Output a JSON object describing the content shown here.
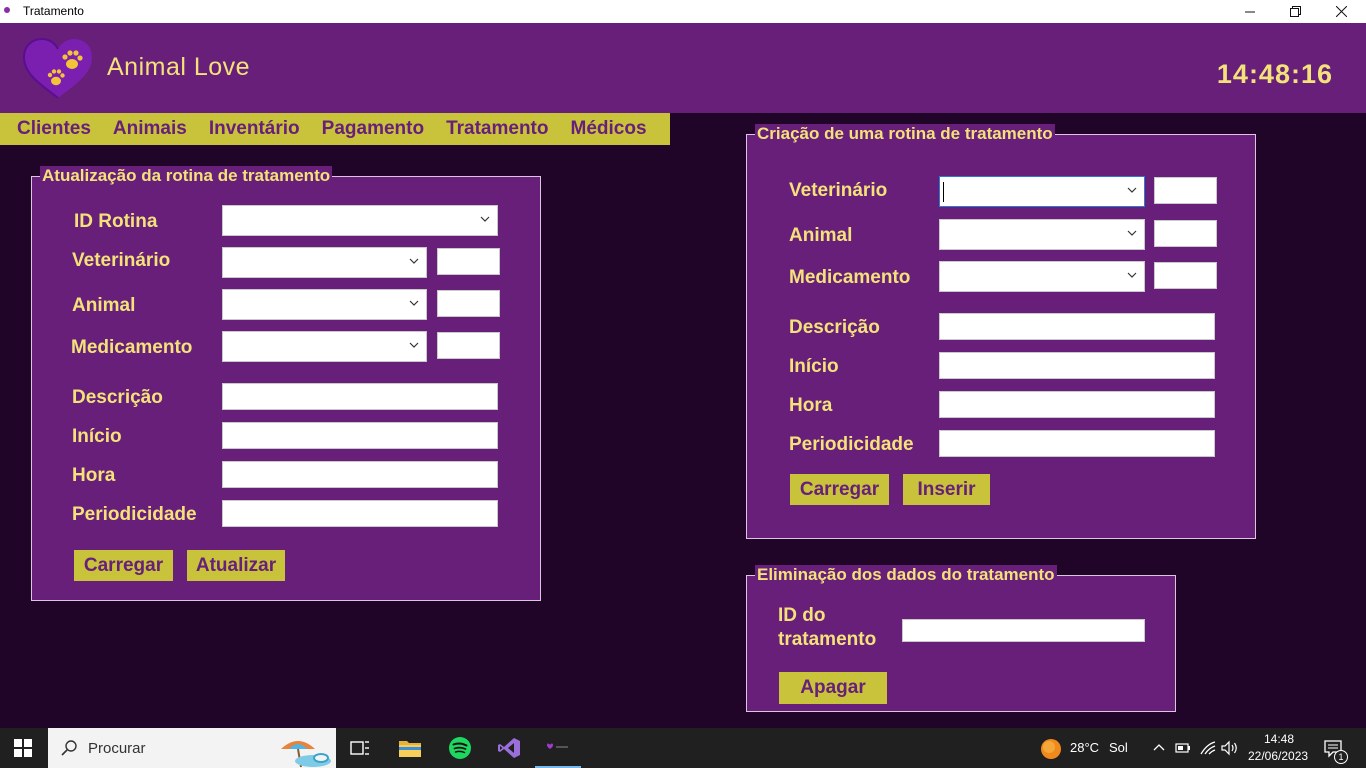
{
  "window": {
    "title": "Tratamento",
    "minimize": "—",
    "restore": "❐",
    "close": "✕"
  },
  "header": {
    "brand": "Animal Love",
    "clock": "14:48:16"
  },
  "menu": [
    "Clientes",
    "Animais",
    "Inventário",
    "Pagamento",
    "Tratamento",
    "Médicos"
  ],
  "update_panel": {
    "caption": "Atualização da rotina de tratamento",
    "labels": {
      "id_rotina": "ID Rotina",
      "veterinario": "Veterinário",
      "animal": "Animal",
      "medicamento": "Medicamento",
      "descricao": "Descrição",
      "inicio": "Início",
      "hora": "Hora",
      "periodicidade": "Periodicidade"
    },
    "buttons": {
      "carregar": "Carregar",
      "atualizar": "Atualizar"
    }
  },
  "create_panel": {
    "caption": "Criação de uma rotina de tratamento",
    "labels": {
      "veterinario": "Veterinário",
      "animal": "Animal",
      "medicamento": "Medicamento",
      "descricao": "Descrição",
      "inicio": "Início",
      "hora": "Hora",
      "periodicidade": "Periodicidade"
    },
    "buttons": {
      "carregar": "Carregar",
      "inserir": "Inserir"
    }
  },
  "delete_panel": {
    "caption": "Eliminação dos dados do tratamento",
    "label_line1": "ID do",
    "label_line2": "tratamento",
    "button": "Apagar"
  },
  "taskbar": {
    "search_placeholder": "Procurar",
    "weather_temp": "28°C",
    "weather_desc": "Sol",
    "time": "14:48",
    "date": "22/06/2023",
    "notification_count": "1"
  },
  "colors": {
    "background": "#210529",
    "panel": "#671f7a",
    "accent": "#c8c33a",
    "label": "#f3e27a"
  }
}
